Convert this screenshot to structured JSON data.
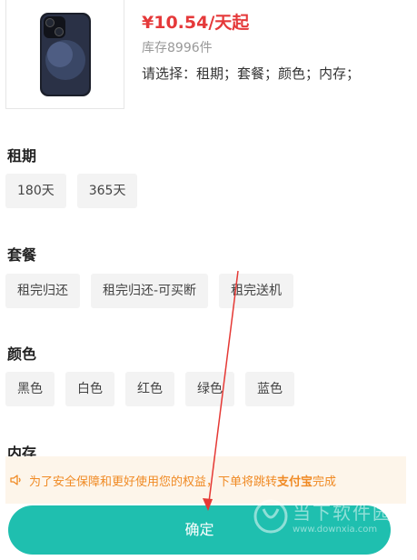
{
  "product": {
    "price": "¥10.54/天起",
    "stock": "库存8996件",
    "prompt": "请选择：租期；套餐；颜色；内存；"
  },
  "sections": {
    "term": {
      "title": "租期",
      "options": [
        "180天",
        "365天"
      ]
    },
    "plan": {
      "title": "套餐",
      "options": [
        "租完归还",
        "租完归还-可买断",
        "租完送机"
      ]
    },
    "color": {
      "title": "颜色",
      "options": [
        "黑色",
        "白色",
        "红色",
        "绿色",
        "蓝色"
      ]
    },
    "storage": {
      "title": "内存"
    }
  },
  "notice": {
    "before": "为了安全保障和更好使用您的权益，下单将跳转",
    "highlight": "支付宝",
    "after": "完成"
  },
  "confirm_label": "确定",
  "watermark": {
    "text": "当下软件园",
    "url": "www.downxia.com"
  },
  "colors": {
    "accent": "#1fbfaf",
    "price": "#e5393a",
    "notice": "#f08a24",
    "annotation": "#e53935"
  }
}
